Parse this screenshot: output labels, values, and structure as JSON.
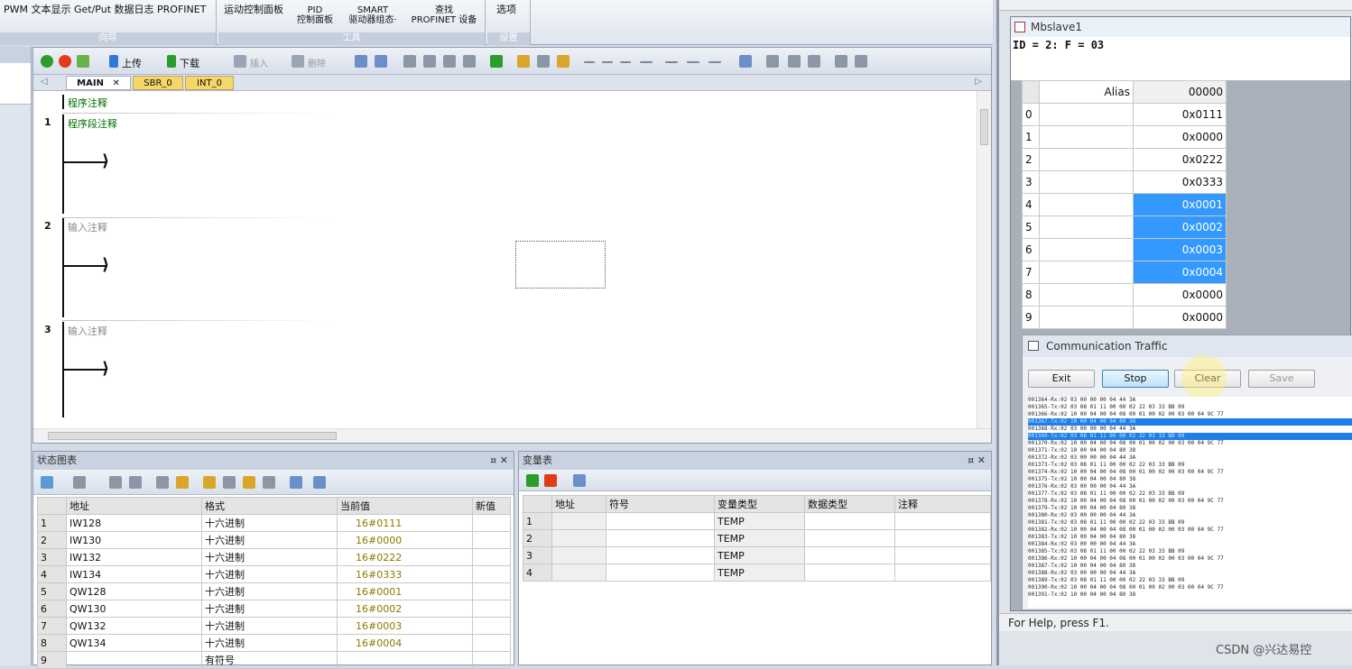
{
  "ribbon": {
    "group1_items": "PWM  文本显示  Get/Put  数据日志  PROFINET",
    "group1_title": "向导",
    "group2_item1": "运动控制面板",
    "group2_item2_l1": "PID",
    "group2_item2_l2": "控制面板",
    "group2_item3_l1": "SMART",
    "group2_item3_l2": "驱动器组态·",
    "group2_item4_l1": "查找",
    "group2_item4_l2": "PROFINET 设备",
    "group2_title": "工具",
    "group3_item": "选项",
    "group3_title": "设置"
  },
  "toolbar": {
    "upload": "上传",
    "download": "下载",
    "insert": "插入",
    "delete": "删除"
  },
  "tabs": [
    "MAIN",
    "SBR_0",
    "INT_0"
  ],
  "program": {
    "program_comment": "程序注释",
    "networks": [
      {
        "num": "1",
        "comment": "程序段注释"
      },
      {
        "num": "2",
        "comment": "输入注释"
      },
      {
        "num": "3",
        "comment": "输入注释"
      }
    ]
  },
  "statchart": {
    "title": "状态图表",
    "headers": [
      "地址",
      "格式",
      "当前值",
      "新值"
    ],
    "rows": [
      {
        "n": "1",
        "addr": "IW128",
        "fmt": "十六进制",
        "cur": "16#0111"
      },
      {
        "n": "2",
        "addr": "IW130",
        "fmt": "十六进制",
        "cur": "16#0000"
      },
      {
        "n": "3",
        "addr": "IW132",
        "fmt": "十六进制",
        "cur": "16#0222"
      },
      {
        "n": "4",
        "addr": "IW134",
        "fmt": "十六进制",
        "cur": "16#0333"
      },
      {
        "n": "5",
        "addr": "QW128",
        "fmt": "十六进制",
        "cur": "16#0001"
      },
      {
        "n": "6",
        "addr": "QW130",
        "fmt": "十六进制",
        "cur": "16#0002"
      },
      {
        "n": "7",
        "addr": "QW132",
        "fmt": "十六进制",
        "cur": "16#0003"
      },
      {
        "n": "8",
        "addr": "QW134",
        "fmt": "十六进制",
        "cur": "16#0004"
      },
      {
        "n": "9",
        "addr": "",
        "fmt": "有符号",
        "cur": ""
      }
    ]
  },
  "vartable": {
    "title": "变量表",
    "headers": [
      "地址",
      "符号",
      "变量类型",
      "数据类型",
      "注释"
    ],
    "rows": [
      {
        "n": "1",
        "type": "TEMP"
      },
      {
        "n": "2",
        "type": "TEMP"
      },
      {
        "n": "3",
        "type": "TEMP"
      },
      {
        "n": "4",
        "type": "TEMP"
      }
    ]
  },
  "mbslave": {
    "title": "Mbslave1",
    "id_line": "ID = 2: F = 03",
    "alias_header": "Alias",
    "col_header": "00000",
    "rows": [
      {
        "i": "0",
        "v": "0x0111",
        "sel": false
      },
      {
        "i": "1",
        "v": "0x0000",
        "sel": false
      },
      {
        "i": "2",
        "v": "0x0222",
        "sel": false
      },
      {
        "i": "3",
        "v": "0x0333",
        "sel": false
      },
      {
        "i": "4",
        "v": "0x0001",
        "sel": true
      },
      {
        "i": "5",
        "v": "0x0002",
        "sel": true
      },
      {
        "i": "6",
        "v": "0x0003",
        "sel": true
      },
      {
        "i": "7",
        "v": "0x0004",
        "sel": true
      },
      {
        "i": "8",
        "v": "0x0000",
        "sel": false
      },
      {
        "i": "9",
        "v": "0x0000",
        "sel": false
      }
    ]
  },
  "comm": {
    "title": "Communication Traffic",
    "buttons": {
      "exit": "Exit",
      "stop": "Stop",
      "clear": "Clear",
      "save": "Save"
    },
    "log": [
      "001364-Rx:02 03 00 00 00 04 44 3A",
      "001365-Tx:02 03 08 01 11 00 00 02 22 03 33 BB 09",
      "001366-Rx:02 10 00 04 00 04 08 00 01 00 02 00 03 00 04 9C 77",
      "001367-Tx:02 10 00 04 00 04 80 38",
      "001368-Rx:02 03 00 00 00 04 44 3A",
      "001369-Tx:02 03 08 01 11 00 00 02 22 03 33 BB 09",
      "001370-Rx:02 10 00 04 00 04 08 00 01 00 02 00 03 00 04 9C 77",
      "001371-Tx:02 10 00 04 00 04 80 38",
      "001372-Rx:02 03 00 00 00 04 44 3A",
      "001373-Tx:02 03 08 01 11 00 00 02 22 03 33 BB 09",
      "001374-Rx:02 10 00 04 00 04 08 00 01 00 02 00 03 00 04 9C 77",
      "001375-Tx:02 10 00 04 00 04 80 38",
      "001376-Rx:02 03 00 00 00 04 44 3A",
      "001377-Tx:02 03 08 01 11 00 00 02 22 03 33 BB 09",
      "001378-Rx:02 10 00 04 00 04 08 00 01 00 02 00 03 00 04 9C 77",
      "001379-Tx:02 10 00 04 00 04 80 38",
      "001380-Rx:02 03 00 00 00 04 44 3A",
      "001381-Tx:02 03 08 01 11 00 00 02 22 03 33 BB 09",
      "001382-Rx:02 10 00 04 00 04 08 00 01 00 02 00 03 00 04 9C 77",
      "001383-Tx:02 10 00 04 00 04 80 38",
      "001384-Rx:02 03 00 00 00 04 44 3A",
      "001385-Tx:02 03 08 01 11 00 00 02 22 03 33 BB 09",
      "001386-Rx:02 10 00 04 00 04 08 00 01 00 02 00 03 00 04 9C 77",
      "001387-Tx:02 10 00 04 00 04 80 38",
      "001388-Rx:02 03 00 00 00 04 44 3A",
      "001389-Tx:02 03 08 01 11 00 00 02 22 03 33 BB 09",
      "001390-Rx:02 10 00 04 00 04 08 00 01 00 02 00 03 00 04 9C 77",
      "001391-Tx:02 10 00 04 00 04 80 38"
    ],
    "highlight_rows": [
      3,
      5
    ]
  },
  "statusbar": "For Help, press F1.",
  "watermark": "CSDN @兴达易控",
  "colors": {
    "selection": "#3399ff",
    "current_value": "#8a7a00",
    "comment_green": "#007000"
  }
}
